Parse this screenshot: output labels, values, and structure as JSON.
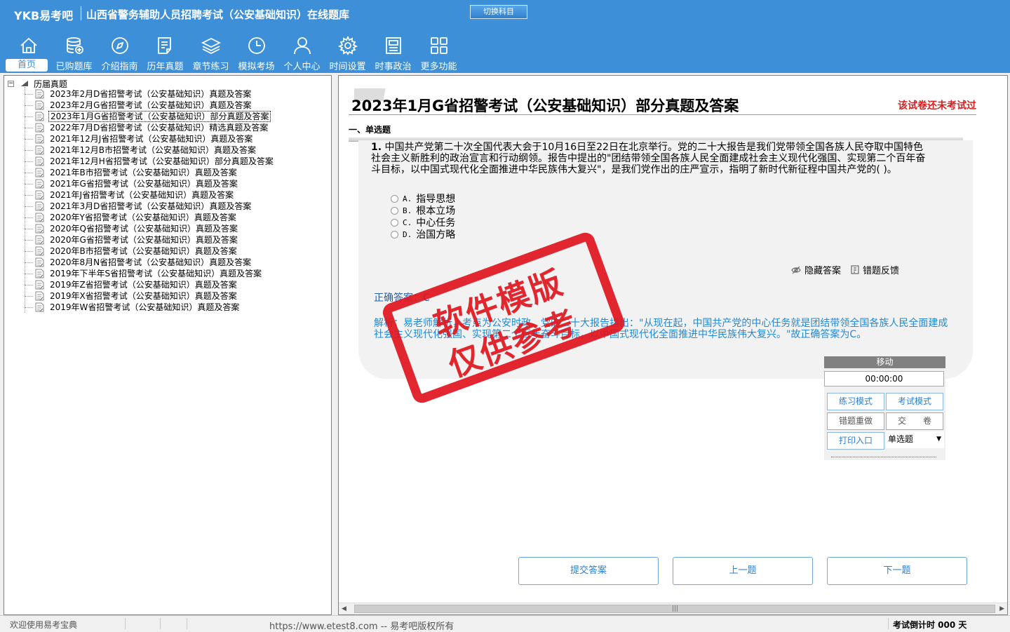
{
  "header": {
    "logo": "YKB易考吧",
    "title": "山西省警务辅助人员招聘考试（公安基础知识）在线题库",
    "switch_button": "切换科目",
    "brand_color": "#3d8fd8"
  },
  "nav": [
    {
      "label": "首页",
      "icon": "home-icon",
      "active": true
    },
    {
      "label": "已购题库",
      "icon": "database-icon"
    },
    {
      "label": "介绍指南",
      "icon": "compass-icon"
    },
    {
      "label": "历年真题",
      "icon": "document-list-icon"
    },
    {
      "label": "章节练习",
      "icon": "layers-icon"
    },
    {
      "label": "模拟考场",
      "icon": "clock-icon"
    },
    {
      "label": "个人中心",
      "icon": "user-icon"
    },
    {
      "label": "时间设置",
      "icon": "gear-icon"
    },
    {
      "label": "时事政治",
      "icon": "news-icon"
    },
    {
      "label": "更多功能",
      "icon": "grid-icon"
    }
  ],
  "tree": {
    "root": "历届真题",
    "items": [
      "2023年2月D省招警考试（公安基础知识）真题及答案",
      "2023年2月G省招警考试（公安基础知识）真题及答案",
      "2023年1月G省招警考试（公安基础知识）部分真题及答案",
      "2022年7月D省招警考试（公安基础知识）精选真题及答案",
      "2021年12月J省招警考试（公安基础知识）真题及答案",
      "2021年12月B市招警考试（公安基础知识）真题及答案",
      "2021年12月H省招警考试（公安基础知识）部分真题及答案",
      "2021年B市招警考试（公安基础知识）真题及答案",
      "2021年G省招警考试（公安基础知识）真题及答案",
      "2021年J省招警考试（公安基础知识）真题及答案",
      "2021年3月D省招警考试（公安基础知识）真题及答案",
      "2020年Y省招警考试（公安基础知识）真题及答案",
      "2020年Q省招警考试（公安基础知识）真题及答案",
      "2020年G省招警考试（公安基础知识）真题及答案",
      "2020年B市招警考试（公安基础知识）真题及答案",
      "2020年8月N省招警考试（公安基础知识）真题及答案",
      "2019年下半年S省招警考试（公安基础知识）真题及答案",
      "2019年Z省招警考试（公安基础知识）真题及答案",
      "2019年X省招警考试（公安基础知识）真题及答案",
      "2019年W省招警考试（公安基础知识）真题及答案"
    ],
    "selected_index": 2
  },
  "paper": {
    "title": "2023年1月G省招警考试（公安基础知识）部分真题及答案",
    "status": "该试卷还未考试过",
    "section": "一、单选题"
  },
  "question": {
    "number": "1.",
    "text": "中国共产党第二十次全国代表大会于10月16日至22日在北京举行。党的二十大报告是我们党带领全国各族人民夺取中国特色社会主义新胜利的政治宣言和行动纲领。报告中提出的\"团结带领全国各族人民全面建成社会主义现代化强国、实现第二个百年奋斗目标，以中国式现代化全面推进中华民族伟大复兴\"，是我们党作出的庄严宣示，指明了新时代新征程中国共产党的(  )。",
    "options": [
      {
        "key": "A.",
        "text": "指导思想"
      },
      {
        "key": "B.",
        "text": "根本立场"
      },
      {
        "key": "C.",
        "text": "中心任务"
      },
      {
        "key": "D.",
        "text": "治国方略"
      }
    ],
    "hide_answer": "隐藏答案",
    "report_error": "错题反馈",
    "answer_line": "正确答案：C",
    "analysis": "解析：易老师解析，考点为公安时政。党的二十大报告指出：\"从现在起，中国共产党的中心任务就是团结带领全国各族人民全面建成社会主义现代化强国、实现第二个百年奋斗目标，以中国式现代化全面推进中华民族伟大复兴。\"故正确答案为C。"
  },
  "stamp": {
    "line1": "软件模版",
    "line2": "仅供参考",
    "color": "#e0151e"
  },
  "control": {
    "move": "移动",
    "timer": "00:00:00",
    "practice_mode": "练习模式",
    "exam_mode": "考试模式",
    "redo_wrong": "错题重做",
    "submit_paper": "交　　卷",
    "print_entry": "打印入口",
    "type_select": "单选题"
  },
  "buttons": {
    "submit": "提交答案",
    "prev": "上一题",
    "next": "下一题"
  },
  "status": {
    "welcome": "欢迎使用易考宝典",
    "copyright": "https://www.etest8.com -- 易考吧版权所有",
    "countdown": "考试倒计时 000 天"
  }
}
